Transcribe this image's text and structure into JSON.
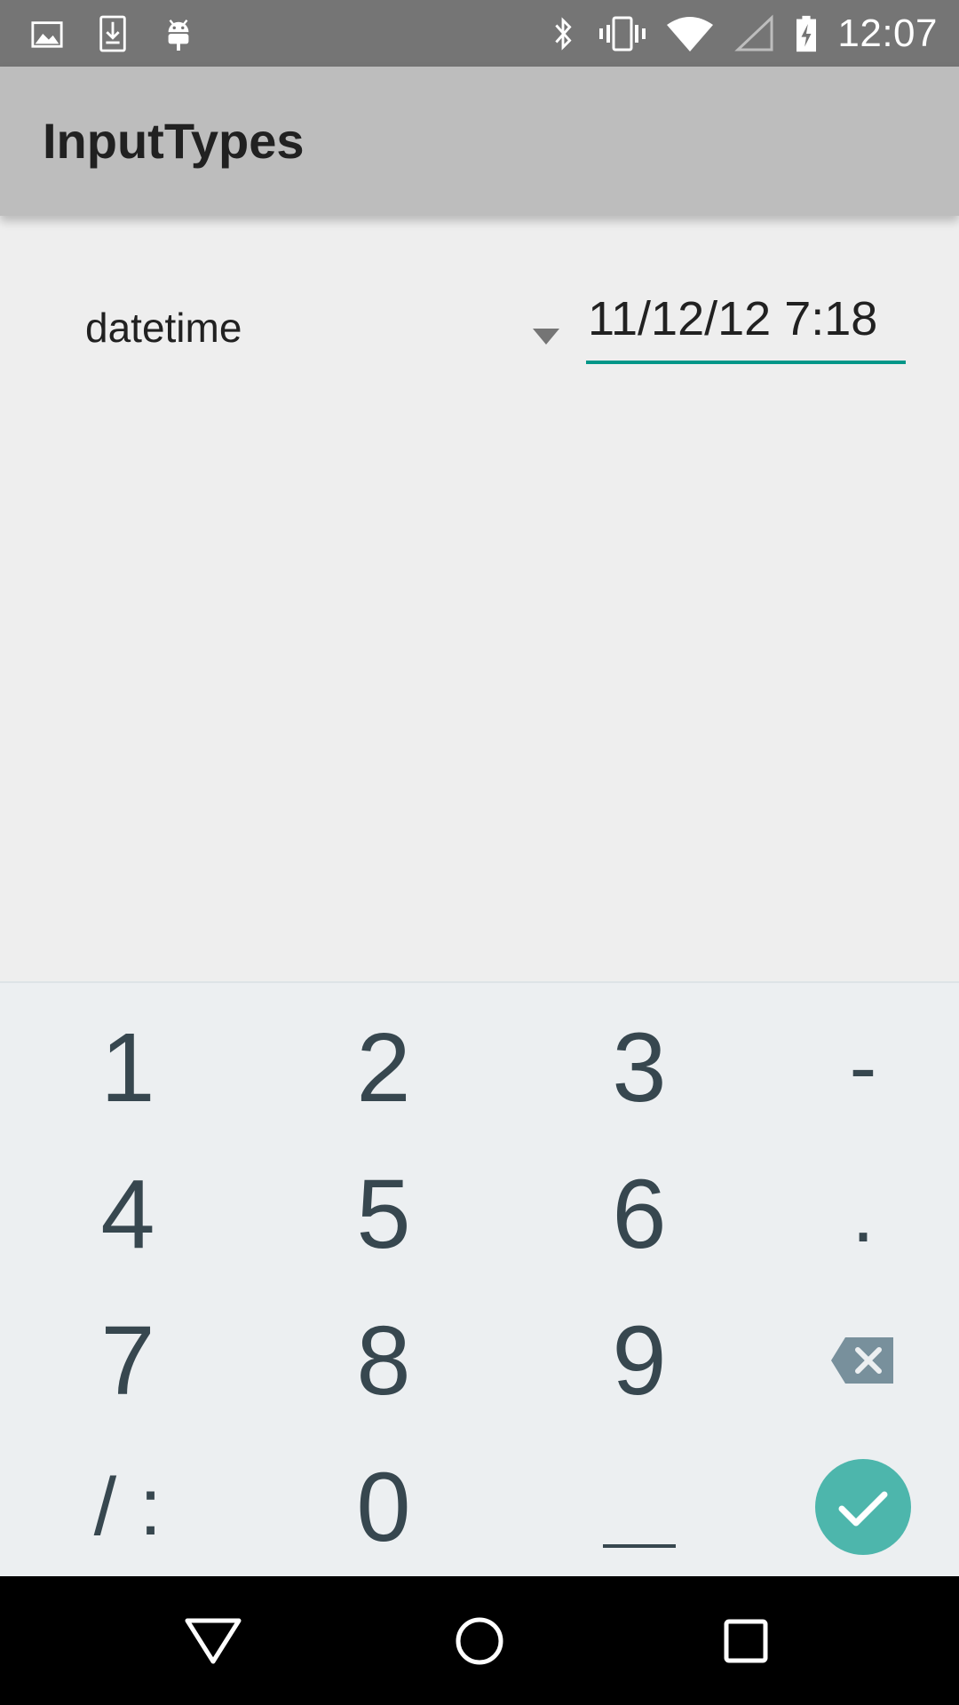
{
  "status_bar": {
    "time": "12:07",
    "left_icons": [
      "image-icon",
      "download-icon",
      "android-icon"
    ],
    "right_icons": [
      "bluetooth-icon",
      "vibrate-icon",
      "wifi-icon",
      "cellular-icon",
      "battery-charging-icon"
    ]
  },
  "app_bar": {
    "title": "InputTypes"
  },
  "spinner": {
    "label": "datetime",
    "icon": "dropdown-arrow-icon"
  },
  "edit_text": {
    "value": "11/12/12 7:18",
    "underline_color": "#009688"
  },
  "keyboard": {
    "rows": [
      [
        "1",
        "2",
        "3",
        "-"
      ],
      [
        "4",
        "5",
        "6",
        "."
      ],
      [
        "7",
        "8",
        "9",
        "backspace"
      ],
      [
        "/ :",
        "0",
        "space",
        "done"
      ]
    ],
    "key_color": "#37474f",
    "done_color": "#4db6ac",
    "background": "#eceff1"
  },
  "nav_bar": {
    "buttons": [
      "back-icon",
      "home-icon",
      "recents-icon"
    ]
  }
}
